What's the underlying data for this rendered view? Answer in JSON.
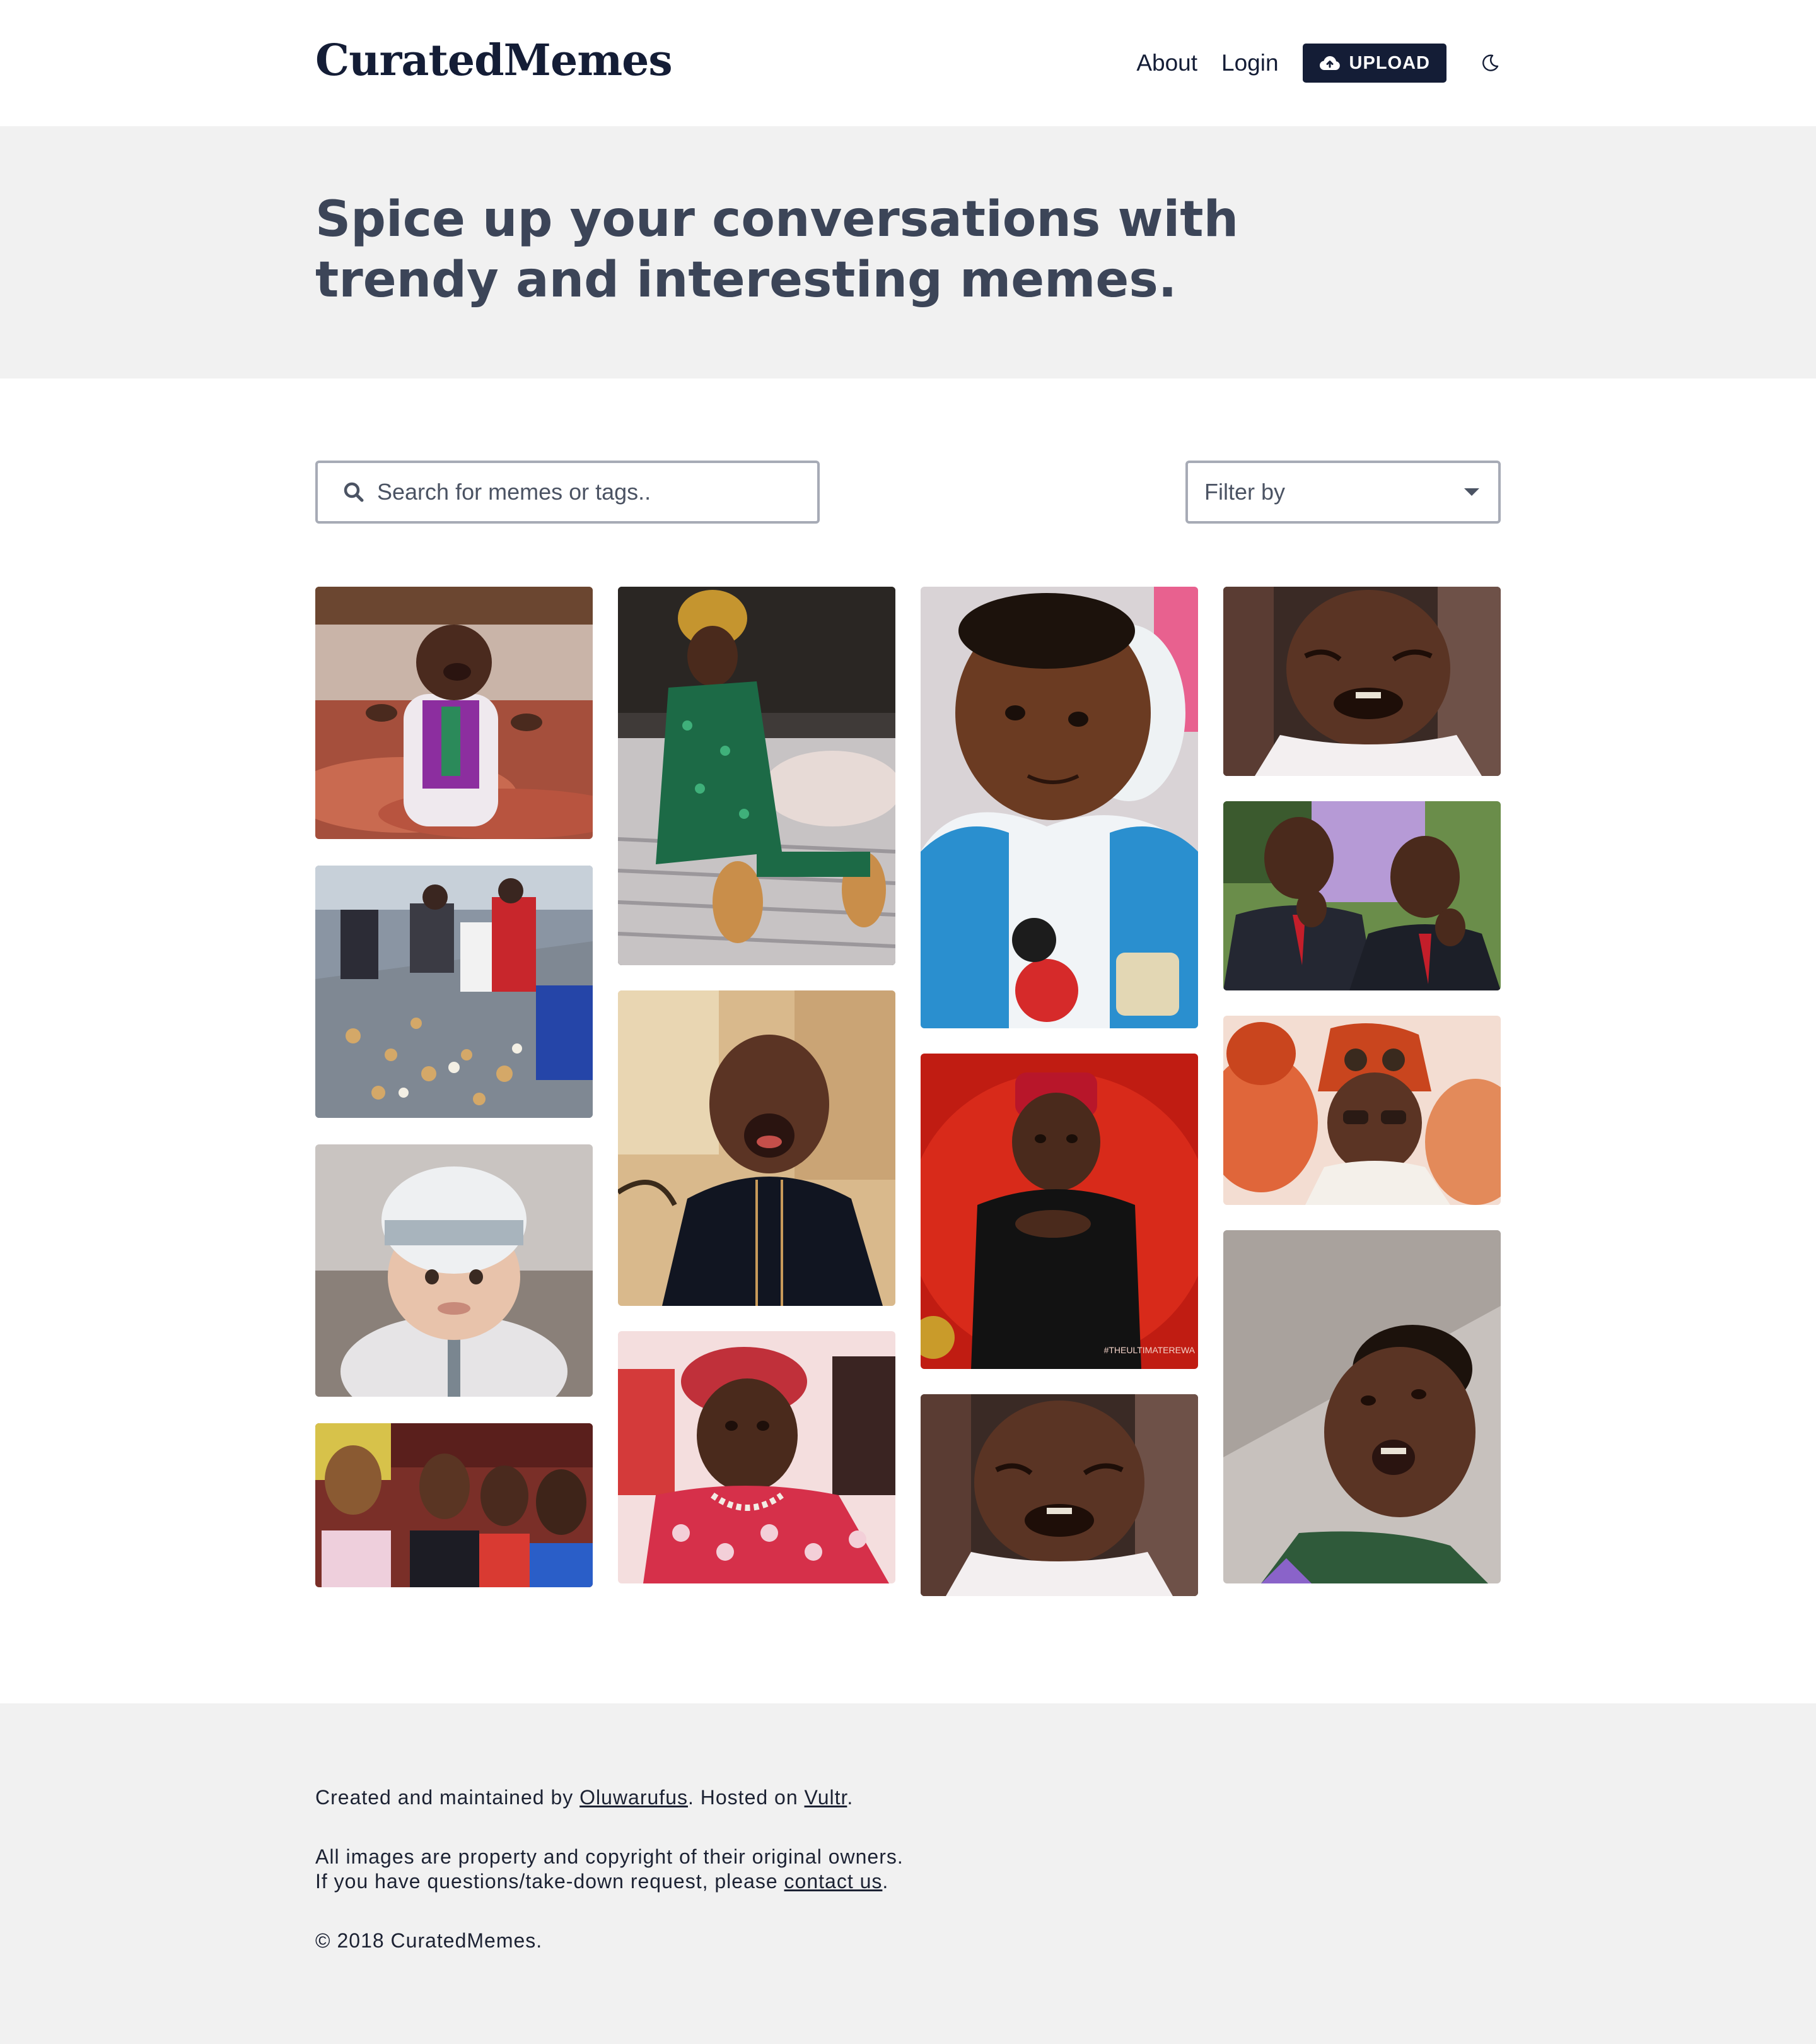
{
  "header": {
    "logo": "CuratedMemes",
    "nav": {
      "about": "About",
      "login": "Login",
      "upload": "UPLOAD"
    },
    "icons": {
      "upload": "cloud-upload-icon",
      "theme": "moon-icon"
    }
  },
  "hero": {
    "title_line1": "Spice up your conversations with",
    "title_line2": "trendy and interesting memes."
  },
  "search": {
    "placeholder": "Search for memes or tags.."
  },
  "filter": {
    "selected": "Filter by"
  },
  "gallery": {
    "tiles": [
      {
        "name": "meme-laughing-child"
      },
      {
        "name": "meme-crowd-picking-food"
      },
      {
        "name": "meme-baby-white-hat"
      },
      {
        "name": "meme-women-shocked"
      },
      {
        "name": "meme-man-sitting-on-bed"
      },
      {
        "name": "meme-man-shouting"
      },
      {
        "name": "meme-woman-red-beret"
      },
      {
        "name": "meme-smiling-toddler"
      },
      {
        "name": "meme-man-red-cap"
      },
      {
        "name": "meme-man-crying"
      },
      {
        "name": "meme-man-crying-2"
      },
      {
        "name": "meme-two-men-pondering"
      },
      {
        "name": "meme-man-hat-glasses"
      },
      {
        "name": "meme-boy-looking-up"
      }
    ],
    "overlay_text": {
      "red_cap_caption": "#THEULTIMATEREWA"
    }
  },
  "footer": {
    "line1_prefix": "Created and maintained by ",
    "line1_link1": "Oluwarufus",
    "line1_middle": ". Hosted on ",
    "line1_link2": "Vultr",
    "line1_suffix": ".",
    "line2": "All images are property and copyright of their original owners.",
    "line3_prefix": "If you have questions/take-down request, please ",
    "line3_link": "contact us",
    "line3_suffix": ".",
    "copyright": "© 2018 CuratedMemes."
  },
  "colors": {
    "brand": "#141d36",
    "hero_bg": "#f1f1f1",
    "heading": "#3c4558"
  }
}
